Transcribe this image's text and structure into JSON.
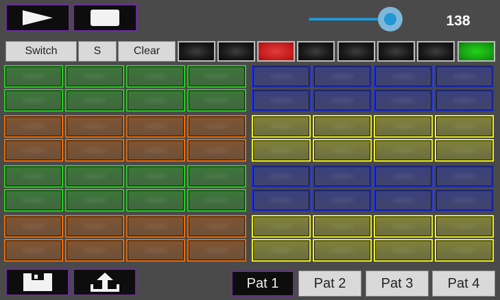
{
  "colors": {
    "accent": "#2196d3",
    "track": "#2196d3",
    "thumb_halo": "#7fb7da",
    "button_border": "#6a2c9a",
    "green": "#21d11a",
    "orange": "#f06a00",
    "blue": "#1a2ee8",
    "yellow": "#eef21a"
  },
  "transport": {
    "play_icon": "play-icon",
    "stop_icon": "stop-icon"
  },
  "tempo": {
    "value": "138",
    "slider_level": 0.86
  },
  "toolbar": {
    "switch_label": "Switch",
    "s_label": "S",
    "clear_label": "Clear"
  },
  "steps": [
    {
      "state": "off"
    },
    {
      "state": "off"
    },
    {
      "state": "red"
    },
    {
      "state": "off"
    },
    {
      "state": "off"
    },
    {
      "state": "off"
    },
    {
      "state": "off"
    },
    {
      "state": "green"
    }
  ],
  "grid": {
    "rows": [
      [
        "green",
        "blue"
      ],
      [
        "green",
        "blue"
      ],
      [
        "orange",
        "yellow"
      ],
      [
        "orange",
        "yellow"
      ],
      [
        "green",
        "blue"
      ],
      [
        "green",
        "blue"
      ],
      [
        "orange",
        "yellow"
      ],
      [
        "orange",
        "yellow"
      ]
    ]
  },
  "footer": {
    "save_icon": "save-icon",
    "upload_icon": "upload-icon",
    "patterns": [
      {
        "label": "Pat 1",
        "active": true
      },
      {
        "label": "Pat 2",
        "active": false
      },
      {
        "label": "Pat 3",
        "active": false
      },
      {
        "label": "Pat 4",
        "active": false
      }
    ]
  }
}
